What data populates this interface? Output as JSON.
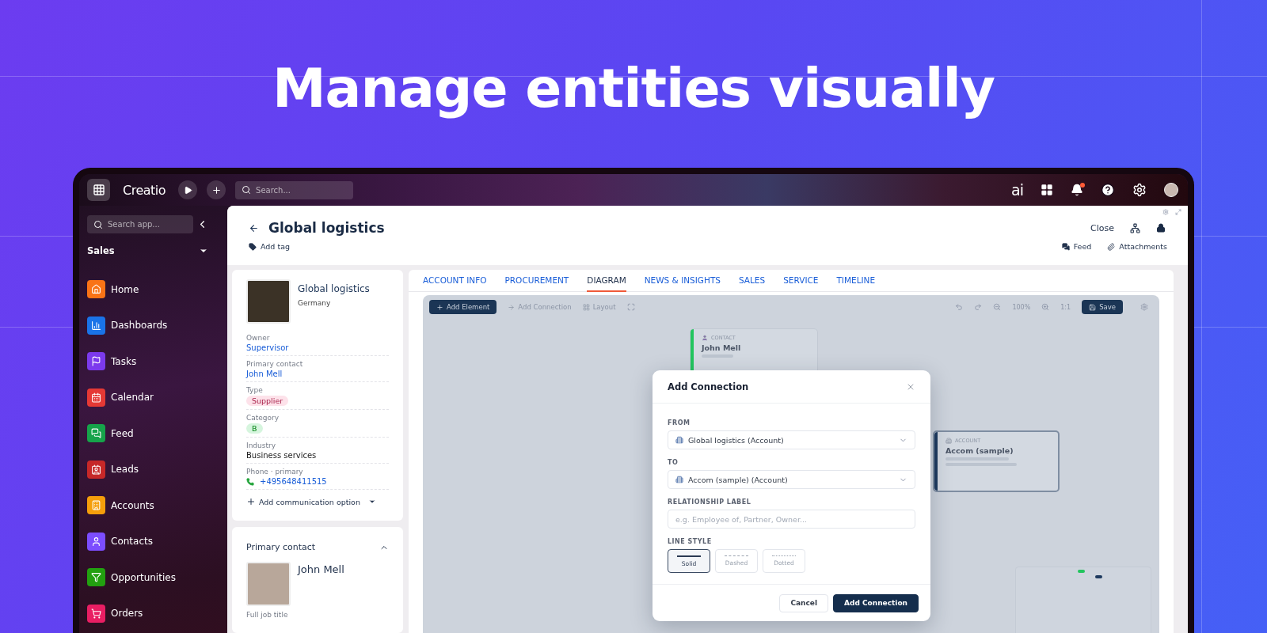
{
  "headline": "Manage entities visually",
  "topbar": {
    "logo": "Creatio",
    "search_placeholder": "Search...",
    "ai_label": "ai",
    "notification": true
  },
  "sidebar": {
    "search_placeholder": "Search app...",
    "workspace": "Sales",
    "items": [
      {
        "label": "Home",
        "color": "#f97316"
      },
      {
        "label": "Dashboards",
        "color": "#1a73e8"
      },
      {
        "label": "Tasks",
        "color": "#7c3aed"
      },
      {
        "label": "Calendar",
        "color": "#e53935"
      },
      {
        "label": "Feed",
        "color": "#16a34a"
      },
      {
        "label": "Leads",
        "color": "#c62828"
      },
      {
        "label": "Accounts",
        "color": "#f59e0b"
      },
      {
        "label": "Contacts",
        "color": "#7c4dff"
      },
      {
        "label": "Opportunities",
        "color": "#22a010"
      },
      {
        "label": "Orders",
        "color": "#e91e63"
      }
    ]
  },
  "record": {
    "title": "Global logistics",
    "add_tag": "Add tag",
    "close": "Close",
    "links": [
      "Feed",
      "Attachments"
    ]
  },
  "profile": {
    "name": "Global logistics",
    "country": "Germany",
    "fields": [
      {
        "label": "Owner",
        "value": "Supervisor",
        "kind": "link"
      },
      {
        "label": "Primary contact",
        "value": "John Mell",
        "kind": "link"
      },
      {
        "label": "Type",
        "value": "Supplier",
        "kind": "tag",
        "color": "#fde2ea"
      },
      {
        "label": "Category",
        "value": "B",
        "kind": "tag",
        "color": "#d6f5de"
      },
      {
        "label": "Industry",
        "value": "Business services",
        "kind": "text"
      },
      {
        "label": "Phone · primary",
        "value": "+495648411515",
        "kind": "phone"
      }
    ],
    "add_option": "Add communication option"
  },
  "contact_card": {
    "title": "Primary contact",
    "expanded": true,
    "name": "John Mell",
    "field_label": "Full job title"
  },
  "tabs": [
    {
      "label": "ACCOUNT INFO",
      "selected": false
    },
    {
      "label": "PROCUREMENT",
      "selected": false
    },
    {
      "label": "DIAGRAM",
      "selected": true
    },
    {
      "label": "NEWS & INSIGHTS",
      "selected": false
    },
    {
      "label": "SALES",
      "selected": false
    },
    {
      "label": "SERVICE",
      "selected": false
    },
    {
      "label": "TIMELINE",
      "selected": false
    }
  ],
  "diagram": {
    "toolbar": {
      "add_element": "Add Element",
      "add_connection": "Add Connection",
      "layout": "Layout",
      "zoom": "100%",
      "fit": "1:1",
      "save": "Save"
    },
    "nodes": [
      {
        "kind": "contact",
        "type_label": "CONTACT",
        "name": "John Mell",
        "color": "#22c55e"
      },
      {
        "kind": "account",
        "type_label": "ACCOUNT",
        "name": "Accom (sample)",
        "color": "#1e3a5f"
      }
    ]
  },
  "dialog": {
    "title": "Add Connection",
    "fields": [
      {
        "label": "FROM",
        "value": "Global logistics (Account)",
        "kind": "select"
      },
      {
        "label": "TO",
        "value": "Accom (sample) (Account)",
        "kind": "select"
      },
      {
        "label": "RELATIONSHIP LABEL",
        "placeholder": "e.g. Employee of, Partner, Owner...",
        "kind": "text"
      }
    ],
    "line_style": {
      "label": "LINE STYLE",
      "options": [
        {
          "label": "Solid",
          "kind": "solid",
          "selected": true
        },
        {
          "label": "Dashed",
          "kind": "dashed",
          "selected": false
        },
        {
          "label": "Dotted",
          "kind": "dotted",
          "selected": false
        }
      ]
    },
    "buttons": [
      {
        "label": "Cancel",
        "kind": "secondary"
      },
      {
        "label": "Add Connection",
        "kind": "primary"
      }
    ]
  }
}
